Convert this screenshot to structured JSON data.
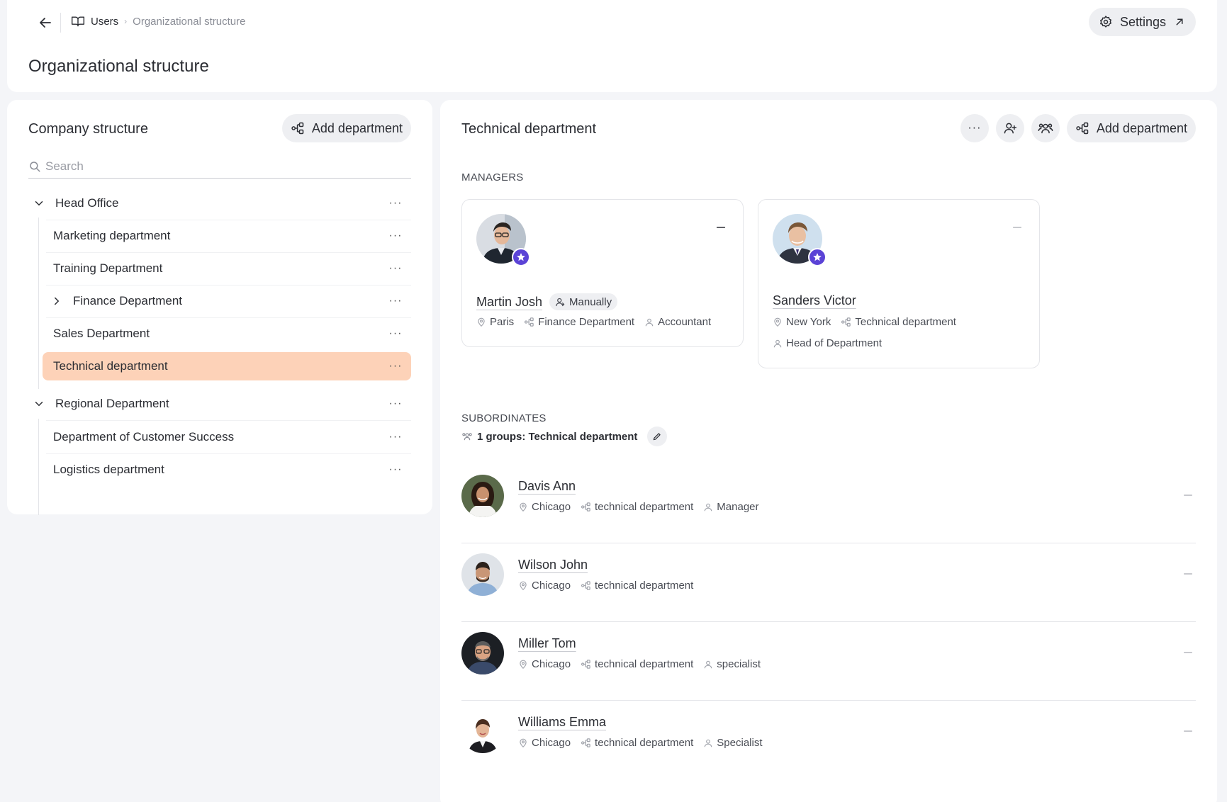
{
  "header": {
    "breadcrumb_users": "Users",
    "breadcrumb_sep": "›",
    "breadcrumb_current": "Organizational structure",
    "title": "Organizational structure",
    "settings_label": "Settings"
  },
  "left": {
    "title": "Company structure",
    "add_label": "Add department",
    "search_placeholder": "Search",
    "more": "···",
    "tree": [
      {
        "label": "Head Office",
        "level": 0,
        "chevron": "down"
      },
      {
        "label": "Marketing department",
        "level": 1
      },
      {
        "label": "Training Department",
        "level": 1
      },
      {
        "label": "Finance Department",
        "level": 1,
        "chevron": "right"
      },
      {
        "label": "Sales Department",
        "level": 1
      },
      {
        "label": "Technical department",
        "level": 1,
        "selected": true
      },
      {
        "label": "Regional Department",
        "level": 0,
        "chevron": "down"
      },
      {
        "label": "Department of Customer Success",
        "level": 1
      },
      {
        "label": "Logistics department",
        "level": 1
      }
    ]
  },
  "right": {
    "title": "Technical department",
    "more": "···",
    "add_label": "Add department",
    "managers_label": "MANAGERS",
    "subordinates_label": "SUBORDINATES",
    "groups_text": "1 groups: Technical department",
    "managers": [
      {
        "name": "Martin Josh",
        "tag": "Manually",
        "city": "Paris",
        "dept": "Finance Department",
        "role": "Accountant"
      },
      {
        "name": "Sanders Victor",
        "city": "New York",
        "dept": "Technical department",
        "role": "Head of Department"
      }
    ],
    "subordinates": [
      {
        "name": "Davis Ann",
        "city": "Chicago",
        "dept": "technical department",
        "role": "Manager"
      },
      {
        "name": "Wilson John",
        "city": "Chicago",
        "dept": "technical department",
        "role": ""
      },
      {
        "name": "Miller Tom",
        "city": "Chicago",
        "dept": "technical department",
        "role": "specialist"
      },
      {
        "name": "Williams Emma",
        "city": "Chicago",
        "dept": "technical department",
        "role": "Specialist"
      }
    ]
  },
  "colors": {
    "selected_row": "#fdd2b8",
    "badge": "#5b43d6",
    "button_bg": "#eeeff2"
  }
}
